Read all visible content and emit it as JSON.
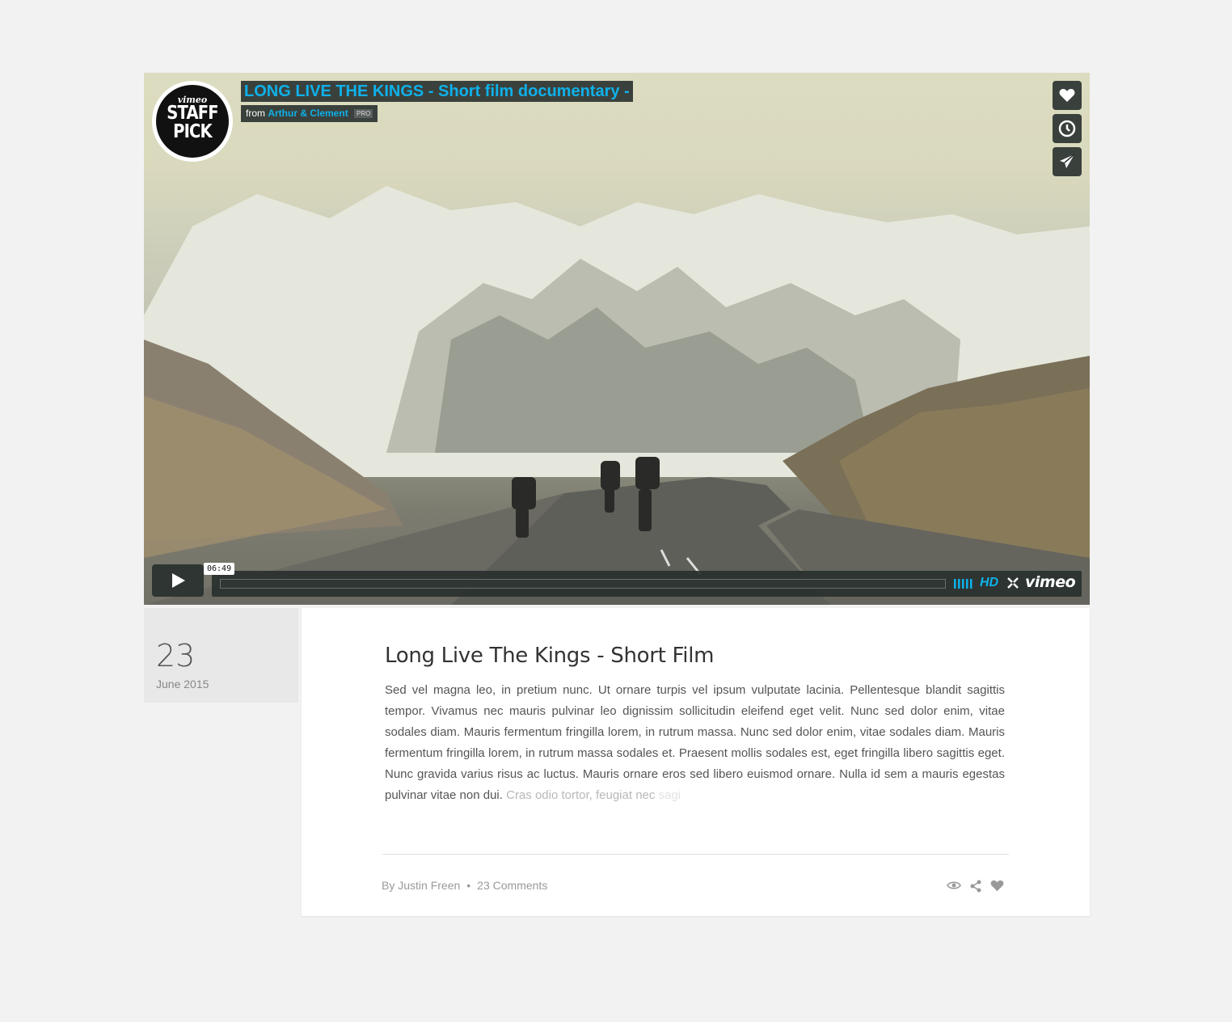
{
  "video": {
    "badge": {
      "brand": "vimeo",
      "text_line1": "STAFF",
      "text_line2": "PICK"
    },
    "title": "LONG LIVE THE KINGS - Short film documentary -",
    "from_label": "from",
    "author": "Arthur & Clement",
    "pro_badge": "PRO",
    "side_buttons": [
      "heart-icon",
      "clock-icon",
      "paper-plane-icon"
    ],
    "timecode": "06:49",
    "hd_label": "HD",
    "vimeo_logo": "vimeo",
    "progress": 0.0
  },
  "post": {
    "date": {
      "day": "23",
      "month_year": "June 2015"
    },
    "title": "Long Live The Kings - Short Film",
    "excerpt": "Sed vel magna leo, in pretium nunc. Ut ornare turpis vel ipsum vulputate lacinia. Pellentesque blandit sagittis tempor. Vivamus nec mauris pulvinar leo dignissim sollicitudin eleifend eget velit. Nunc sed dolor enim, vitae sodales diam. Mauris fermentum fringilla lorem, in rutrum massa. Nunc sed dolor enim, vitae sodales diam. Mauris fermentum fringilla lorem, in rutrum massa sodales et. Praesent mollis sodales est, eget fringilla libero sagittis eget. Nunc gravida varius risus ac luctus. Mauris ornare eros sed libero euismod ornare. Nulla id sem a mauris egestas pulvinar vitae non dui.",
    "excerpt_fade": "Cras odio tortor, feugiat nec",
    "excerpt_fade2": "sagi",
    "author": "By Justin Freen",
    "separator": "•",
    "comments": "23 Comments",
    "action_icons": [
      "eye-icon",
      "share-icon",
      "heart-icon"
    ]
  }
}
